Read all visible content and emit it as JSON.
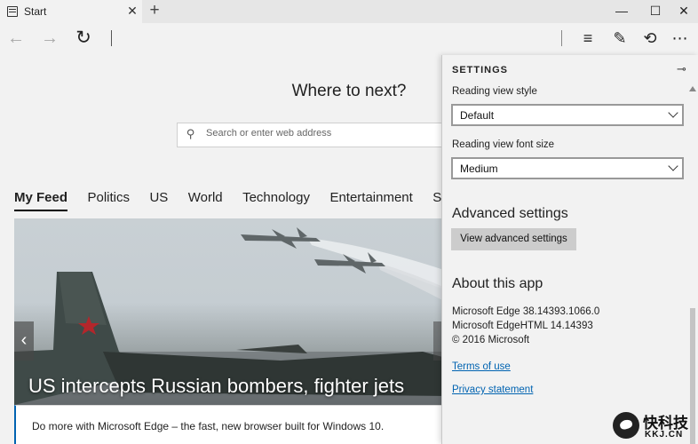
{
  "browser": {
    "tab": {
      "title": "Start",
      "close_glyph": "✕"
    },
    "new_tab_glyph": "+",
    "window_controls": {
      "minimize": "—",
      "maximize": "☐",
      "close": "✕"
    },
    "toolbar": {
      "back_glyph": "←",
      "forward_glyph": "→",
      "refresh_glyph": "↻",
      "hub_glyph": "≡",
      "note_glyph": "✎",
      "share_glyph": "⟲",
      "more_glyph": "⋯"
    }
  },
  "start_page": {
    "heading": "Where to next?",
    "search": {
      "placeholder": "Search or enter web address",
      "icon": "search-icon"
    },
    "feed_tabs": [
      "My Feed",
      "Politics",
      "US",
      "World",
      "Technology",
      "Entertainment",
      "Sports"
    ],
    "hero": {
      "caption": "US intercepts Russian bombers, fighter jets",
      "prev_glyph": "‹"
    },
    "promo": "Do more with Microsoft Edge – the fast, new browser built for Windows 10."
  },
  "settings": {
    "title": "SETTINGS",
    "pin_glyph": "⊸",
    "reading_view_style": {
      "label": "Reading view style",
      "value": "Default"
    },
    "reading_view_font_size": {
      "label": "Reading view font size",
      "value": "Medium"
    },
    "advanced": {
      "heading": "Advanced settings",
      "button": "View advanced settings"
    },
    "about": {
      "heading": "About this app",
      "lines": [
        "Microsoft Edge 38.14393.1066.0",
        "Microsoft EdgeHTML 14.14393",
        "© 2016 Microsoft"
      ],
      "terms_link": "Terms of use",
      "privacy_link": "Privacy statement"
    }
  },
  "watermark": {
    "cn": "快科技",
    "en": "KKJ.CN"
  },
  "colors": {
    "accent": "#0063b1",
    "pane_bg": "#f2f2f2",
    "button_bg": "#cccccc"
  }
}
